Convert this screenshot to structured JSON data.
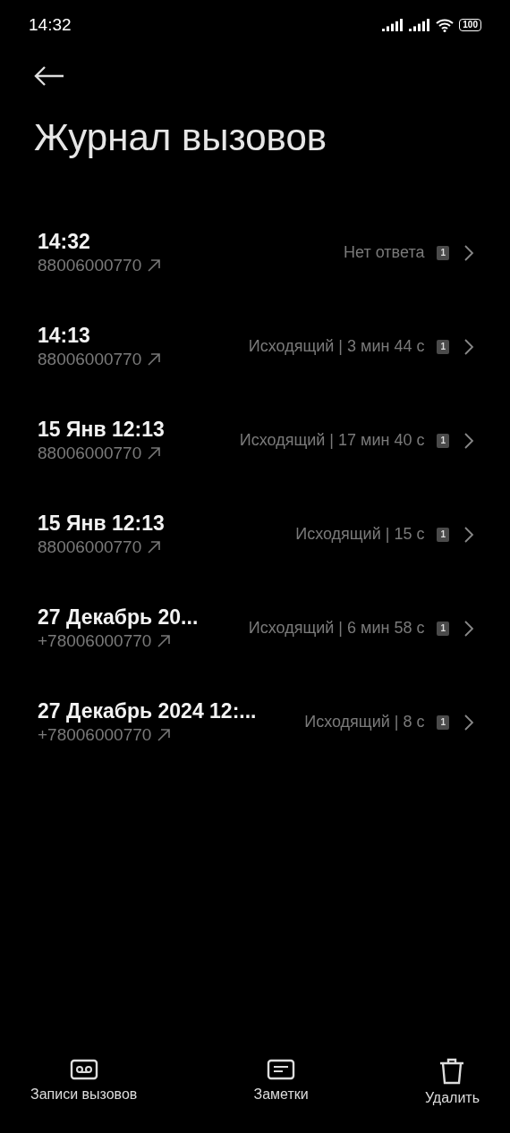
{
  "status_bar": {
    "time": "14:32",
    "battery": "100"
  },
  "header": {
    "title": "Журнал вызовов"
  },
  "calls": [
    {
      "when": "14:32",
      "number": "88006000770",
      "outgoing": true,
      "result": "Нет ответа",
      "sim": "1"
    },
    {
      "when": "14:13",
      "number": "88006000770",
      "outgoing": true,
      "result": "Исходящий | 3 мин 44 с",
      "sim": "1"
    },
    {
      "when": "15 Янв 12:13",
      "number": "88006000770",
      "outgoing": true,
      "result": "Исходящий | 17 мин 40 с",
      "sim": "1"
    },
    {
      "when": "15 Янв 12:13",
      "number": "88006000770",
      "outgoing": true,
      "result": "Исходящий | 15 с",
      "sim": "1"
    },
    {
      "when": "27 Декабрь 20...",
      "number": "+78006000770",
      "outgoing": true,
      "result": "Исходящий | 6 мин 58 с",
      "sim": "1"
    },
    {
      "when": "27 Декабрь 2024 12:...",
      "number": "+78006000770",
      "outgoing": true,
      "result": "Исходящий | 8 с",
      "sim": "1"
    }
  ],
  "bottom_bar": [
    {
      "kind": "recordings",
      "label": "Записи вызовов"
    },
    {
      "kind": "notes",
      "label": "Заметки"
    },
    {
      "kind": "delete",
      "label": "Удалить"
    }
  ]
}
